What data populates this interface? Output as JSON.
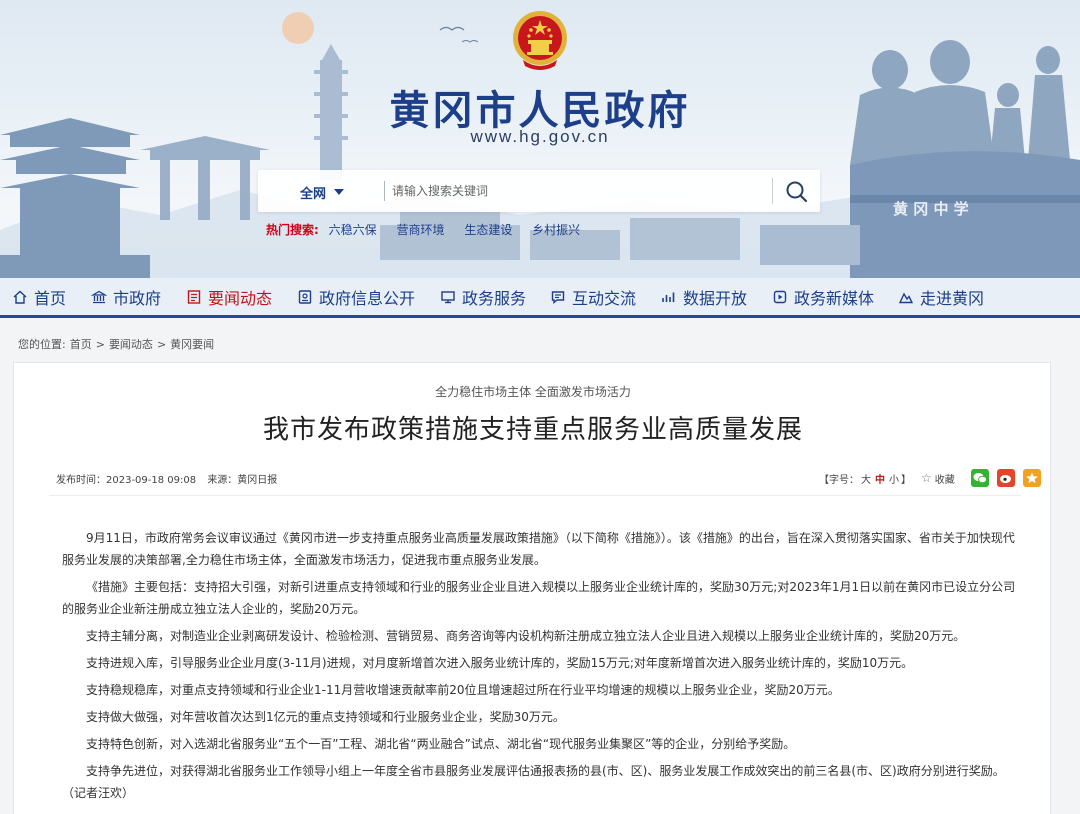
{
  "site": {
    "title": "黄冈市人民政府",
    "url": "www.hg.gov.cn",
    "school_sign": "黄 冈 中 学"
  },
  "search": {
    "scope": "全网",
    "placeholder": "请输入搜索关键词",
    "hot_label": "热门搜索:",
    "hot_items": [
      "六稳六保",
      "营商环境",
      "生态建设",
      "乡村振兴"
    ]
  },
  "nav": {
    "items": [
      {
        "label": "首页",
        "icon": "home-icon"
      },
      {
        "label": "市政府",
        "icon": "bank-icon"
      },
      {
        "label": "要闻动态",
        "icon": "news-icon",
        "active": true
      },
      {
        "label": "政府信息公开",
        "icon": "info-icon"
      },
      {
        "label": "政务服务",
        "icon": "monitor-icon"
      },
      {
        "label": "互动交流",
        "icon": "chat-icon"
      },
      {
        "label": "数据开放",
        "icon": "chart-icon"
      },
      {
        "label": "政务新媒体",
        "icon": "media-icon"
      },
      {
        "label": "走进黄冈",
        "icon": "mountain-icon"
      }
    ]
  },
  "breadcrumb": {
    "prefix": "您的位置:",
    "items": [
      "首页",
      "要闻动态",
      "黄冈要闻"
    ],
    "separator": ">"
  },
  "article": {
    "subtitle": "全力稳住市场主体 全面激发市场活力",
    "title": "我市发布政策措施支持重点服务业高质量发展",
    "published": "发布时间：2023-09-18 09:08",
    "source": "来源：黄冈日报",
    "font_size_label": "【字号：",
    "font_large": "大",
    "font_medium": "中",
    "font_small": "小",
    "font_size_end": "】",
    "favorite": "收藏",
    "paragraphs": [
      "9月11日，市政府常务会议审议通过《黄冈市进一步支持重点服务业高质量发展政策措施》（以下简称《措施》）。该《措施》的出台，旨在深入贯彻落实国家、省市关于加快现代服务业发展的决策部署,全力稳住市场主体，全面激发市场活力，促进我市重点服务业发展。",
      "《措施》主要包括：支持招大引强，对新引进重点支持领域和行业的服务业企业且进入规模以上服务业企业统计库的，奖励30万元;对2023年1月1日以前在黄冈市已设立分公司的服务业企业新注册成立独立法人企业的，奖励20万元。",
      "支持主辅分离，对制造业企业剥离研发设计、检验检测、营销贸易、商务咨询等内设机构新注册成立独立法人企业且进入规模以上服务业企业统计库的，奖励20万元。",
      "支持进规入库，引导服务业企业月度(3-11月)进规，对月度新增首次进入服务业统计库的，奖励15万元;对年度新增首次进入服务业统计库的，奖励10万元。",
      "支持稳规稳库，对重点支持领域和行业企业1-11月营收增速贡献率前20位且增速超过所在行业平均增速的规模以上服务业企业，奖励20万元。",
      "支持做大做强，对年营收首次达到1亿元的重点支持领域和行业服务业企业，奖励30万元。",
      "支持特色创新，对入选湖北省服务业“五个一百”工程、湖北省“两业融合”试点、湖北省“现代服务业集聚区”等的企业，分别给予奖励。",
      "支持争先进位，对获得湖北省服务业工作领导小组上一年度全省市县服务业发展评估通报表扬的县(市、区)、服务业发展工作成效突出的前三名县(市、区)政府分别进行奖励。（记者汪欢）"
    ]
  },
  "colors": {
    "primary": "#1d3f8a",
    "nav_active": "#c4141b",
    "hot_label": "#d0021b"
  }
}
